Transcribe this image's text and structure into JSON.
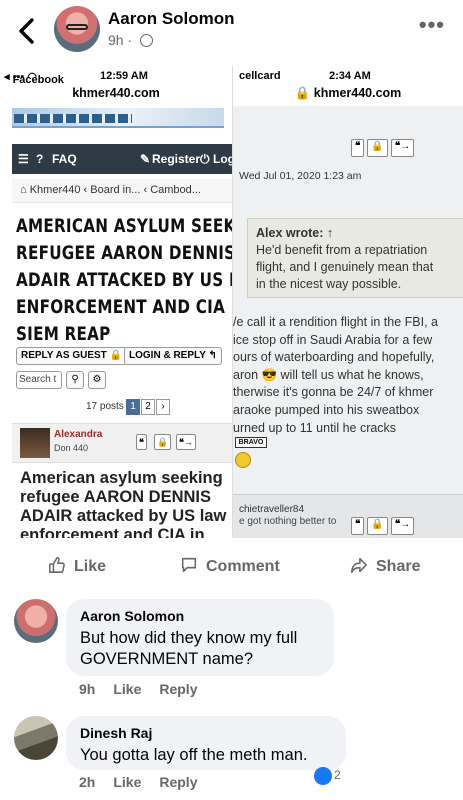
{
  "post": {
    "author": "Aaron Solomon",
    "time": "9h",
    "more_label": "•••",
    "back_icon": "chevron-left-icon",
    "privacy_icon": "globe-icon"
  },
  "left_screenshot": {
    "app": "Facebook",
    "time": "12:59 AM",
    "url": "khmer440.com",
    "nav": {
      "faq": "FAQ",
      "register": "Register",
      "login": "Log"
    },
    "crumbs": [
      "Khmer440",
      "Board in...",
      "Cambod..."
    ],
    "title_lines": [
      "AMERICAN ASYLUM SEEKING",
      "REFUGEE AARON DENNIS",
      "ADAIR ATTACKED BY US LAW",
      "ENFORCEMENT AND CIA IN",
      "SIEM REAP"
    ],
    "reply_button": "REPLY AS GUEST",
    "login_reply_button": "LOGIN & REPLY",
    "search_placeholder": "Search t",
    "posts_count": "17 posts",
    "pages": [
      "1",
      "2"
    ],
    "post_user": "Alexandra",
    "post_rank": "Don 440",
    "post_heading_lines": [
      "American asylum seeking",
      "refugee AARON DENNIS",
      "ADAIR attacked by US law",
      "enforcement and CIA in"
    ]
  },
  "right_screenshot": {
    "carrier": "cellcard",
    "time": "2:34 AM",
    "url": "khmer440.com",
    "date": "Wed Jul 01, 2020 1:23 am",
    "quote_author": "Alex wrote: ↑",
    "quote_lines": [
      "He'd benefit from a repatriation",
      "flight, and I genuinely mean that",
      "in the nicest way possible."
    ],
    "body_lines": [
      "/e call it a rendition flight in the FBI, a",
      "ice stop off in Saudi Arabia for a few",
      "ours of waterboarding and hopefully,",
      "aron 😎 will tell us what he knows,",
      "therwise it's gonna be 24/7 of khmer",
      "araoke pumped into his sweatbox",
      "urned up to 11 until he cracks"
    ],
    "bravo": "BRAVO",
    "username": "chietraveller84",
    "snippet": "e got nothing better to"
  },
  "actions": {
    "like": "Like",
    "comment": "Comment",
    "share": "Share"
  },
  "comments": [
    {
      "name": "Aaron Solomon",
      "text_lines": [
        "But how did they know my full",
        "GOVERNMENT name?"
      ],
      "time": "9h",
      "like": "Like",
      "reply": "Reply"
    },
    {
      "name": "Dinesh Raj",
      "text_lines": [
        "You gotta lay off the meth man."
      ],
      "time": "2h",
      "like": "Like",
      "reply": "Reply",
      "reaction_count": "2"
    }
  ],
  "colors": {
    "fb_blue": "#1877f2",
    "meta_gray": "#65676b",
    "bubble": "#f0f2f5",
    "forum_nav": "#2e3a46"
  }
}
